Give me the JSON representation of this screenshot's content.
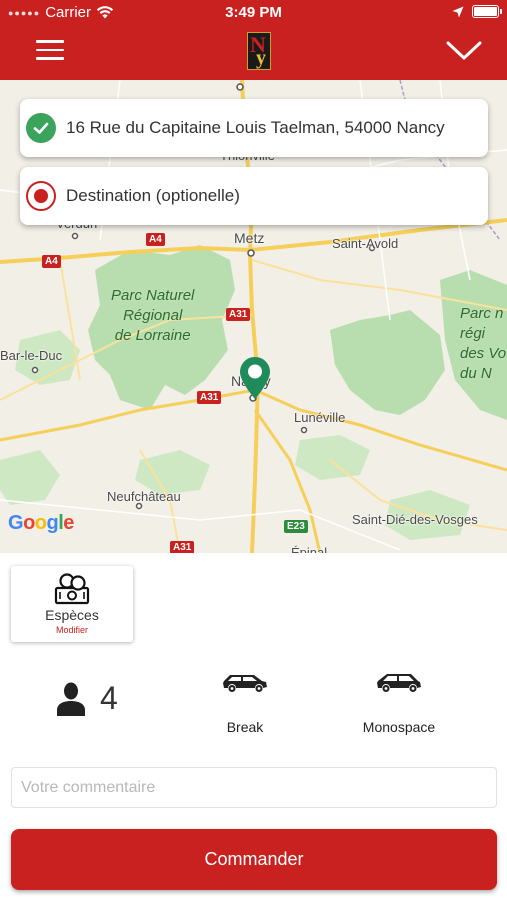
{
  "status_bar": {
    "carrier": "Carrier",
    "time": "3:49 PM"
  },
  "header": {
    "logo_letters": "Ny",
    "icons": [
      "hamburger-menu-icon",
      "chevron-down-icon"
    ]
  },
  "trip": {
    "origin": "16 Rue du Capitaine Louis Taelman, 54000 Nancy",
    "destination_placeholder": "Destination (optionelle)"
  },
  "map": {
    "places": [
      "Thionville",
      "Verdun",
      "Metz",
      "Saint-Avold",
      "Bar-le-Duc",
      "Nancy",
      "Lunéville",
      "Neufchâteau",
      "Saint-Dié-des-Vosges",
      "Épinal"
    ],
    "park_labels": [
      "Parc Naturel\nRégional\nde Lorraine",
      "Parc n\nrégi\ndes Vo\ndu N"
    ],
    "roads": [
      "A4",
      "A4",
      "A31",
      "A31",
      "A31",
      "E23"
    ],
    "attribution": "Google",
    "pin_color": "#1f8a5a"
  },
  "payment": {
    "method": "Espèces",
    "modify": "Modifier"
  },
  "passengers": {
    "count": "4"
  },
  "vehicles": [
    {
      "label": "Break",
      "icon": "station-wagon-icon"
    },
    {
      "label": "Monospace",
      "icon": "minivan-icon"
    }
  ],
  "comment": {
    "placeholder": "Votre commentaire"
  },
  "order": {
    "label": "Commander"
  },
  "colors": {
    "brand_red": "#c8211f",
    "check_green": "#3aa45c"
  }
}
